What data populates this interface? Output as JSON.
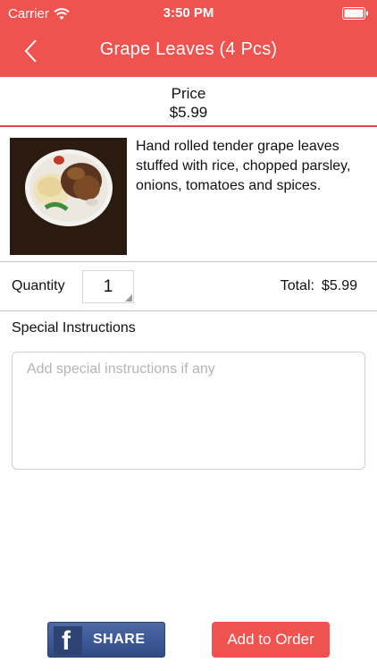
{
  "status_bar": {
    "carrier": "Carrier",
    "time": "3:50 PM"
  },
  "nav": {
    "title": "Grape Leaves (4 Pcs)",
    "back_icon": "chevron-left-icon"
  },
  "price": {
    "label": "Price",
    "value": "$5.99"
  },
  "item": {
    "description": "Hand rolled tender grape leaves stuffed with rice, chopped parsley, onions, tomatoes and spices."
  },
  "quantity": {
    "label": "Quantity",
    "value": "1",
    "total_label": "Total:",
    "total_value": "$5.99"
  },
  "instructions": {
    "label": "Special Instructions",
    "placeholder": "Add special instructions if any"
  },
  "actions": {
    "share_label": "SHARE",
    "fb_glyph": "f",
    "add_label": "Add to Order"
  },
  "colors": {
    "brand": "#ef5350",
    "facebook": "#3b5998"
  }
}
